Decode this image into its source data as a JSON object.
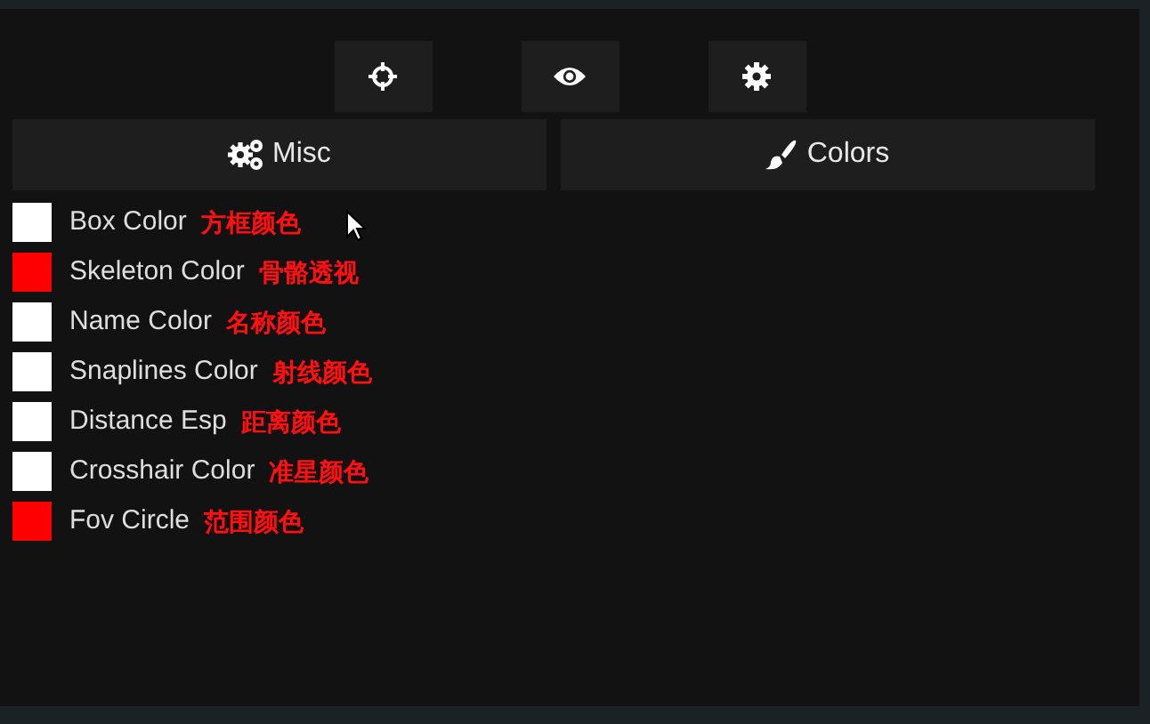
{
  "toolbar": [
    {
      "kind": "crosshair"
    },
    {
      "kind": "eye"
    },
    {
      "kind": "gear"
    }
  ],
  "tabs": [
    {
      "label": "Misc",
      "kind": "gears"
    },
    {
      "label": "Colors",
      "kind": "brush"
    }
  ],
  "colors": [
    {
      "label": "Box Color",
      "color": "#ffffff",
      "note": "方框颜色"
    },
    {
      "label": "Skeleton Color",
      "color": "#ff0000",
      "note": "骨骼透视"
    },
    {
      "label": "Name Color",
      "color": "#ffffff",
      "note": "名称颜色"
    },
    {
      "label": "Snaplines Color",
      "color": "#ffffff",
      "note": "射线颜色"
    },
    {
      "label": "Distance Esp",
      "color": "#ffffff",
      "note": "距离颜色"
    },
    {
      "label": "Crosshair Color",
      "color": "#ffffff",
      "note": "准星颜色"
    },
    {
      "label": "Fov Circle",
      "color": "#ff0000",
      "note": "范围颜色"
    }
  ]
}
